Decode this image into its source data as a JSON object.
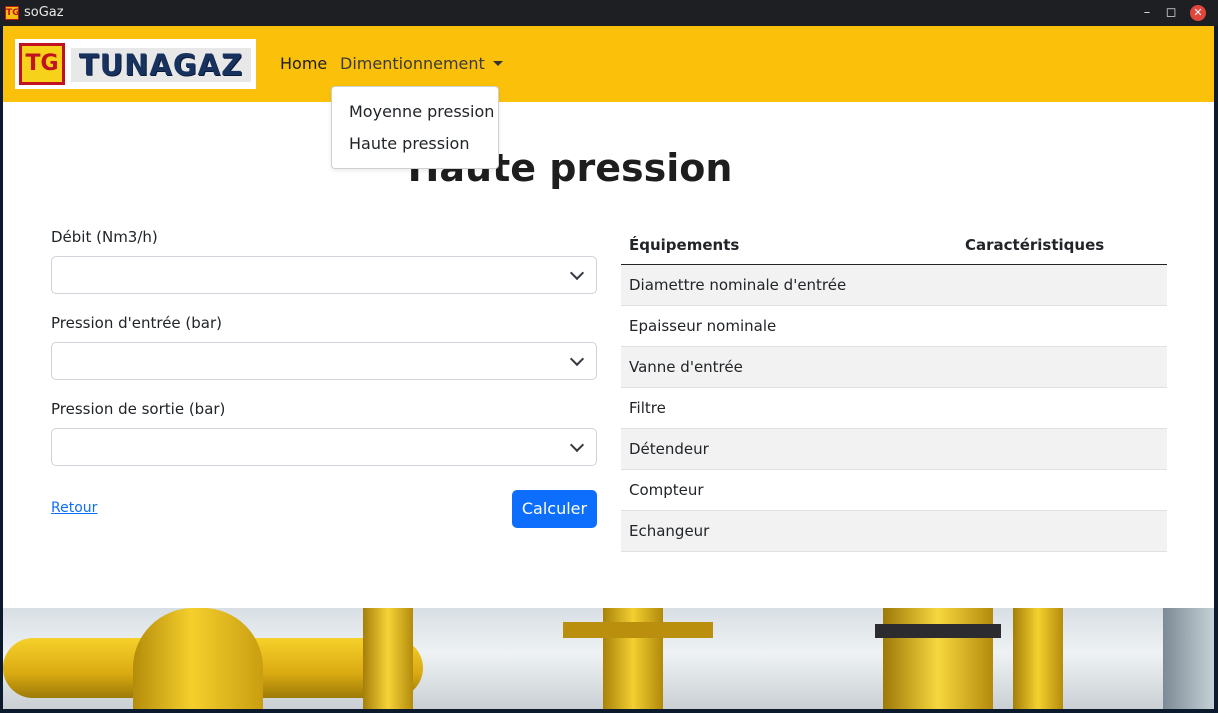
{
  "window": {
    "title": "soGaz",
    "app_icon": "TG",
    "controls": [
      "minimize-icon",
      "maximize-icon",
      "close-icon"
    ]
  },
  "navbar": {
    "logo_mark": "TG",
    "logo_text": "TUNAGAZ",
    "home_label": "Home",
    "menu_label": "Dimentionnement",
    "dropdown_items": [
      "Moyenne pression",
      "Haute pression"
    ],
    "background_color": "#fbc10a"
  },
  "page": {
    "title": "Haute pression"
  },
  "form": {
    "debit_label": "Débit (Nm3/h)",
    "debit_value": "",
    "pression_entree_label": "Pression d'entrée (bar)",
    "pression_entree_value": "",
    "pression_sortie_label": "Pression de sortie (bar)",
    "pression_sortie_value": "",
    "back_link": "Retour",
    "submit_label": "Calculer",
    "accent_color": "#0d6efd"
  },
  "table": {
    "headers": [
      "Équipements",
      "Caractéristiques"
    ],
    "rows": [
      {
        "equipement": "Diamettre nominale d'entrée",
        "caracteristique": ""
      },
      {
        "equipement": "Epaisseur nominale",
        "caracteristique": ""
      },
      {
        "equipement": "Vanne d'entrée",
        "caracteristique": ""
      },
      {
        "equipement": "Filtre",
        "caracteristique": ""
      },
      {
        "equipement": "Détendeur",
        "caracteristique": ""
      },
      {
        "equipement": "Compteur",
        "caracteristique": ""
      },
      {
        "equipement": "Echangeur",
        "caracteristique": ""
      }
    ]
  }
}
